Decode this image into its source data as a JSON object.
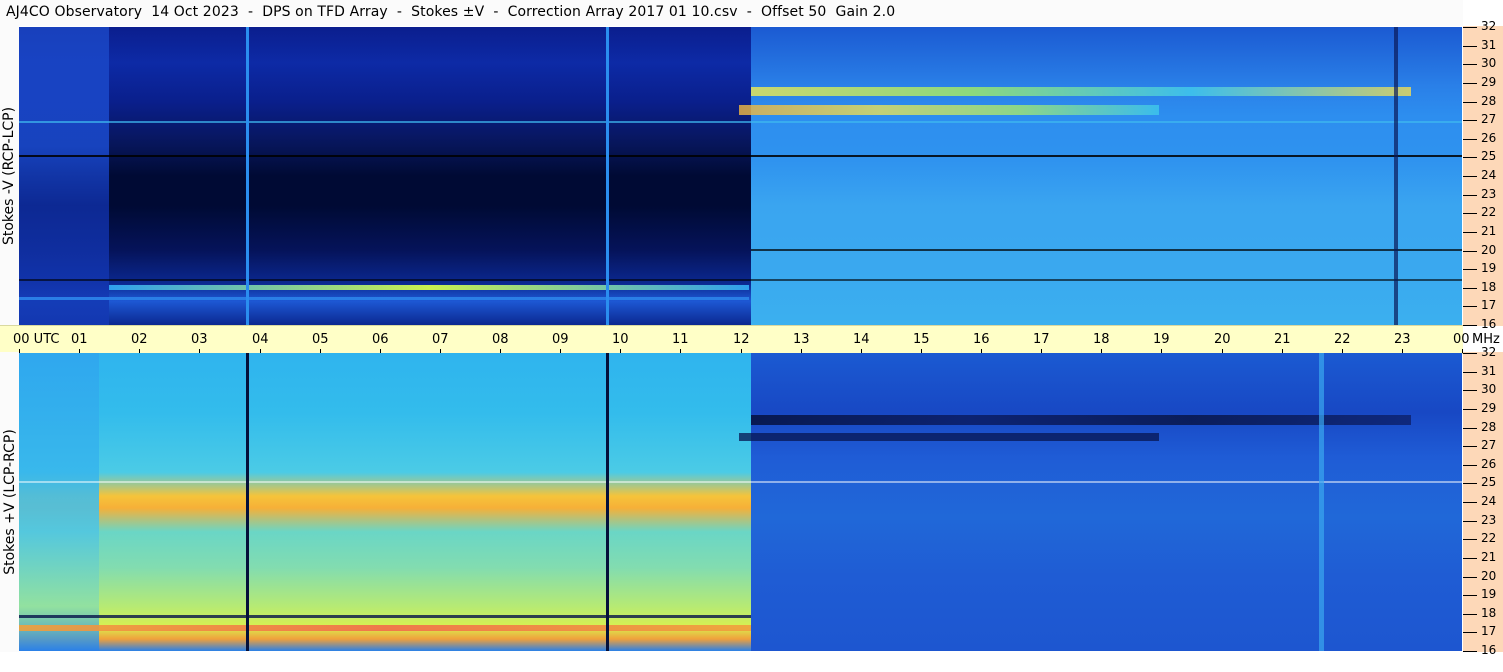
{
  "header": {
    "title": "AJ4CO Observatory  14 Oct 2023  -  DPS on TFD Array  -  Stokes ±V  -  Correction Array 2017 01 10.csv  -  Offset 50  Gain 2.0"
  },
  "panels": {
    "top": {
      "label": "Stokes -V (RCP-LCP)"
    },
    "bottom": {
      "label": "Stokes +V (LCP-RCP)"
    }
  },
  "time_axis": {
    "labels": [
      "00 UTC",
      "01",
      "02",
      "03",
      "04",
      "05",
      "06",
      "07",
      "08",
      "09",
      "10",
      "11",
      "12",
      "13",
      "14",
      "15",
      "16",
      "17",
      "18",
      "19",
      "20",
      "21",
      "22",
      "23",
      "00"
    ],
    "unit": "MHz"
  },
  "freq_axis": {
    "labels": [
      "32",
      "31",
      "30",
      "29",
      "28",
      "27",
      "26",
      "25",
      "24",
      "23",
      "22",
      "21",
      "20",
      "19",
      "18",
      "17",
      "16"
    ]
  },
  "colors": {
    "dark_navy": "#000a3a",
    "deep_blue": "#0a1e96",
    "mid_blue": "#1f5ad6",
    "light_blue": "#2f8ff0",
    "cyan": "#3dc6ec",
    "yellow_green": "#c8f050",
    "orange": "#f6a83a",
    "axis_yellow": "#ffffc7",
    "axis_peach": "#fdd8b8"
  }
}
